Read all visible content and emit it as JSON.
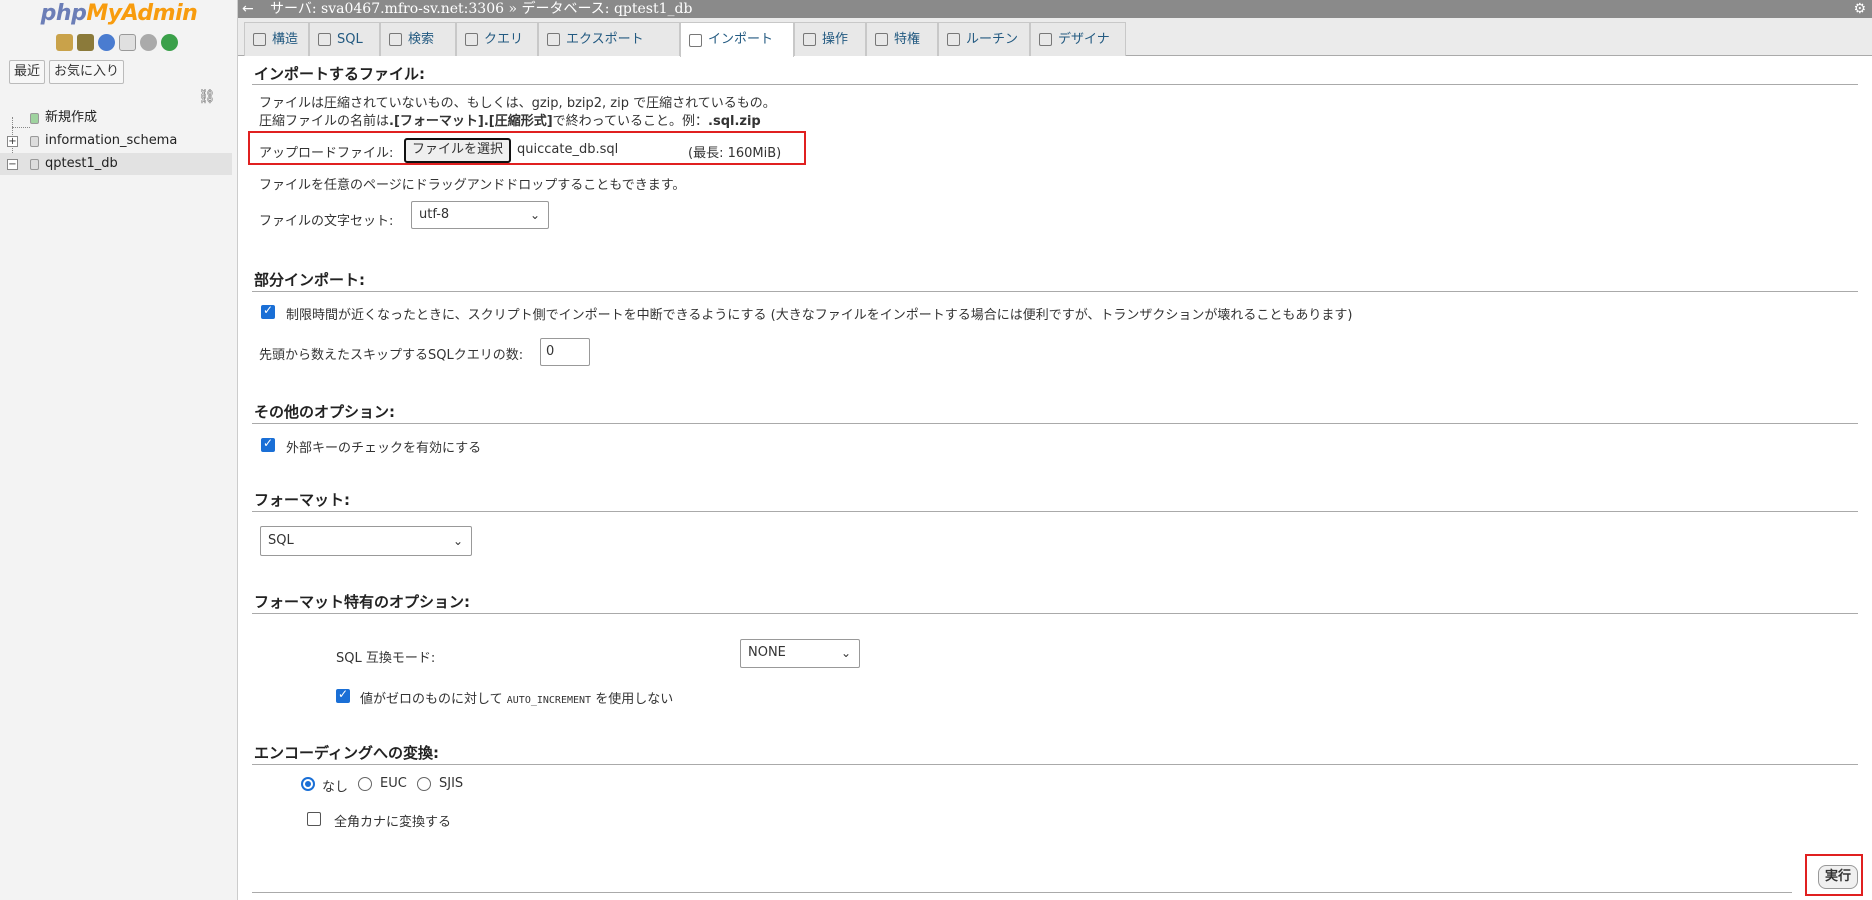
{
  "app": {
    "logo_php": "php",
    "logo_myadmin": "MyAdmin"
  },
  "sidebar": {
    "buttons": [
      "最近",
      "お気に入り"
    ],
    "tree": [
      {
        "label": "新規作成"
      },
      {
        "label": "information_schema"
      },
      {
        "label": "qptest1_db"
      }
    ]
  },
  "topbar": {
    "breadcrumb": "サーバ: sva0467.mfro-sv.net:3306 » データベース: qptest1_db"
  },
  "tabs": [
    "構造",
    "SQL",
    "検索",
    "クエリ",
    "エクスポート",
    "インポート",
    "操作",
    "特権",
    "ルーチン",
    "デザイナ"
  ],
  "import_file": {
    "legend": "インポートするファイル:",
    "desc1": "ファイルは圧縮されていないもの、もしくは、gzip, bzip2, zip で圧縮されているもの。",
    "desc2_a": "圧縮ファイルの名前は",
    "desc2_b": ".[フォーマット].[圧縮形式]",
    "desc2_c": "で終わっていること。例：",
    "desc2_d": ".sql.zip",
    "upload_label": "アップロードファイル:",
    "choose_button": "ファイルを選択",
    "file_name": "quiccate_db.sql",
    "max_size": "(最長: 160MiB)",
    "drag_note": "ファイルを任意のページにドラッグアンドドロップすることもできます。",
    "charset_label": "ファイルの文字セット:",
    "charset_value": "utf-8"
  },
  "partial": {
    "legend": "部分インポート:",
    "interrupt_label": "制限時間が近くなったときに、スクリプト側でインポートを中断できるようにする",
    "interrupt_note": "(大きなファイルをインポートする場合には便利ですが、トランザクションが壊れることもあります)",
    "skip_label": "先頭から数えたスキップするSQLクエリの数:",
    "skip_value": "0"
  },
  "other": {
    "legend": "その他のオプション:",
    "fk_label": "外部キーのチェックを有効にする"
  },
  "format": {
    "legend": "フォーマット:",
    "value": "SQL"
  },
  "format_options": {
    "legend": "フォーマット特有のオプション:",
    "compat_label": "SQL 互換モード:",
    "compat_value": "NONE",
    "autoinc_a": "値がゼロのものに対して",
    "autoinc_code": "AUTO_INCREMENT",
    "autoinc_b": "を使用しない"
  },
  "encoding": {
    "legend": "エンコーディングへの変換:",
    "options": [
      "なし",
      "EUC",
      "SJIS"
    ],
    "selected": "なし",
    "kana_label": "全角カナに変換する"
  },
  "submit": {
    "label": "実行"
  },
  "colors": {
    "highlight_box": "#e02020",
    "checkbox_blue": "#1a6fd6",
    "link_blue": "#235a81"
  }
}
